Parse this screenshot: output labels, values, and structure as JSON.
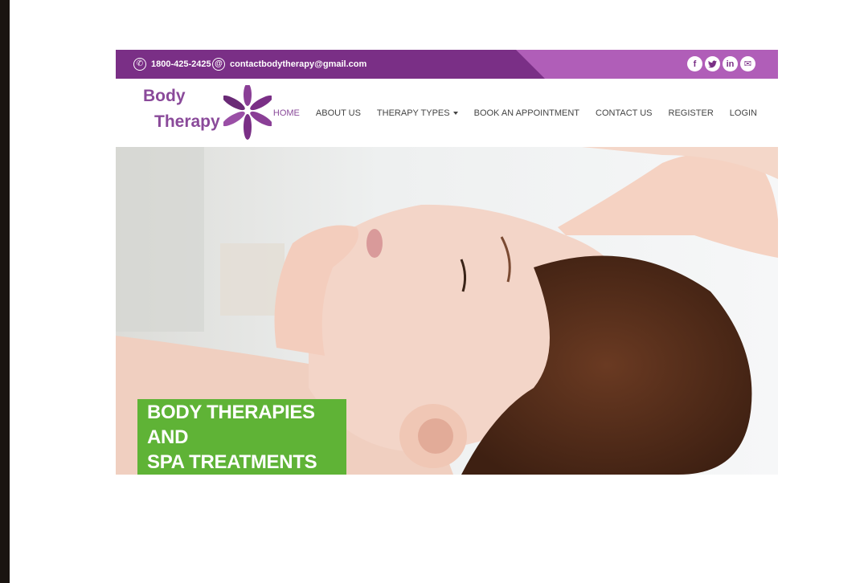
{
  "topbar": {
    "phone": "1800-425-2425",
    "email": "contactbodytherapy@gmail.com",
    "socials": [
      {
        "icon": "facebook-icon",
        "glyph": "f"
      },
      {
        "icon": "twitter-icon",
        "glyph": "t"
      },
      {
        "icon": "linkedin-icon",
        "glyph": "in"
      },
      {
        "icon": "mail-icon",
        "glyph": "✉"
      }
    ]
  },
  "logo": {
    "line1": "Body",
    "line2": "Therapy"
  },
  "nav": {
    "items": [
      "HOME",
      "ABOUT US",
      "THERAPY TYPES",
      "BOOK AN APPOINTMENT",
      "CONTACT US",
      "REGISTER",
      "LOGIN"
    ],
    "active": "HOME"
  },
  "hero": {
    "caption_line1": "BODY THERAPIES AND",
    "caption_line2": "SPA TREATMENTS"
  },
  "colors": {
    "primary": "#7a2f86",
    "accent": "#b05eb8",
    "caption_bg": "#5fb336"
  }
}
